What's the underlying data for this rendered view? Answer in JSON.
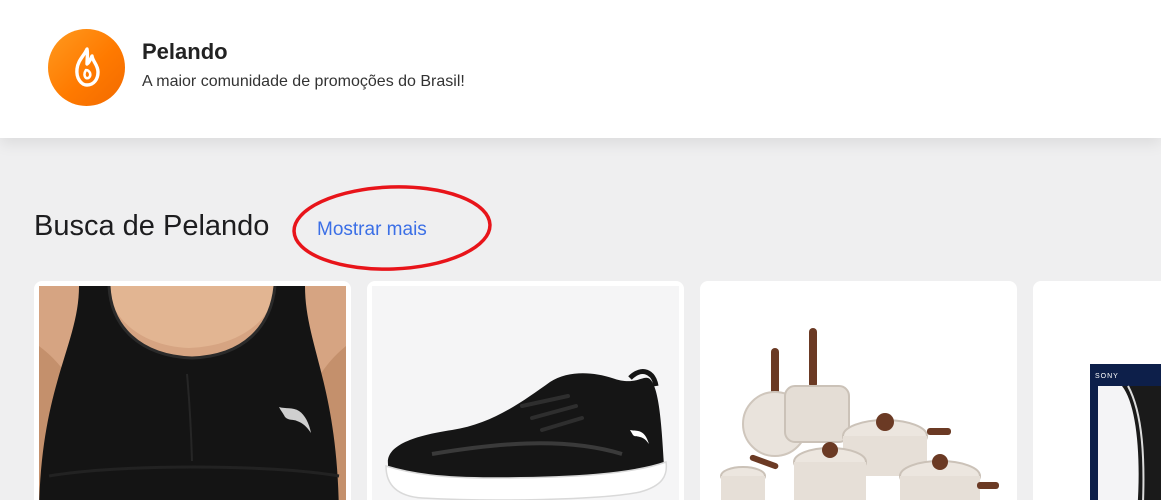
{
  "header": {
    "brand_name": "Pelando",
    "tagline": "A maior comunidade de promoções do Brasil!",
    "logo_icon": "flame-icon",
    "accent_color": "#ff7a00"
  },
  "section": {
    "title": "Busca de Pelando",
    "show_more_label": "Mostrar mais",
    "link_color": "#3b6fe6",
    "annotation_color": "#e8141a"
  },
  "products": [
    {
      "image": "sports-bra-image",
      "brand_logo": "puma-icon"
    },
    {
      "image": "sneaker-image",
      "brand_logo": "puma-icon"
    },
    {
      "image": "cookware-set-image"
    },
    {
      "image": "game-console-image",
      "brand_text": "SONY"
    }
  ]
}
